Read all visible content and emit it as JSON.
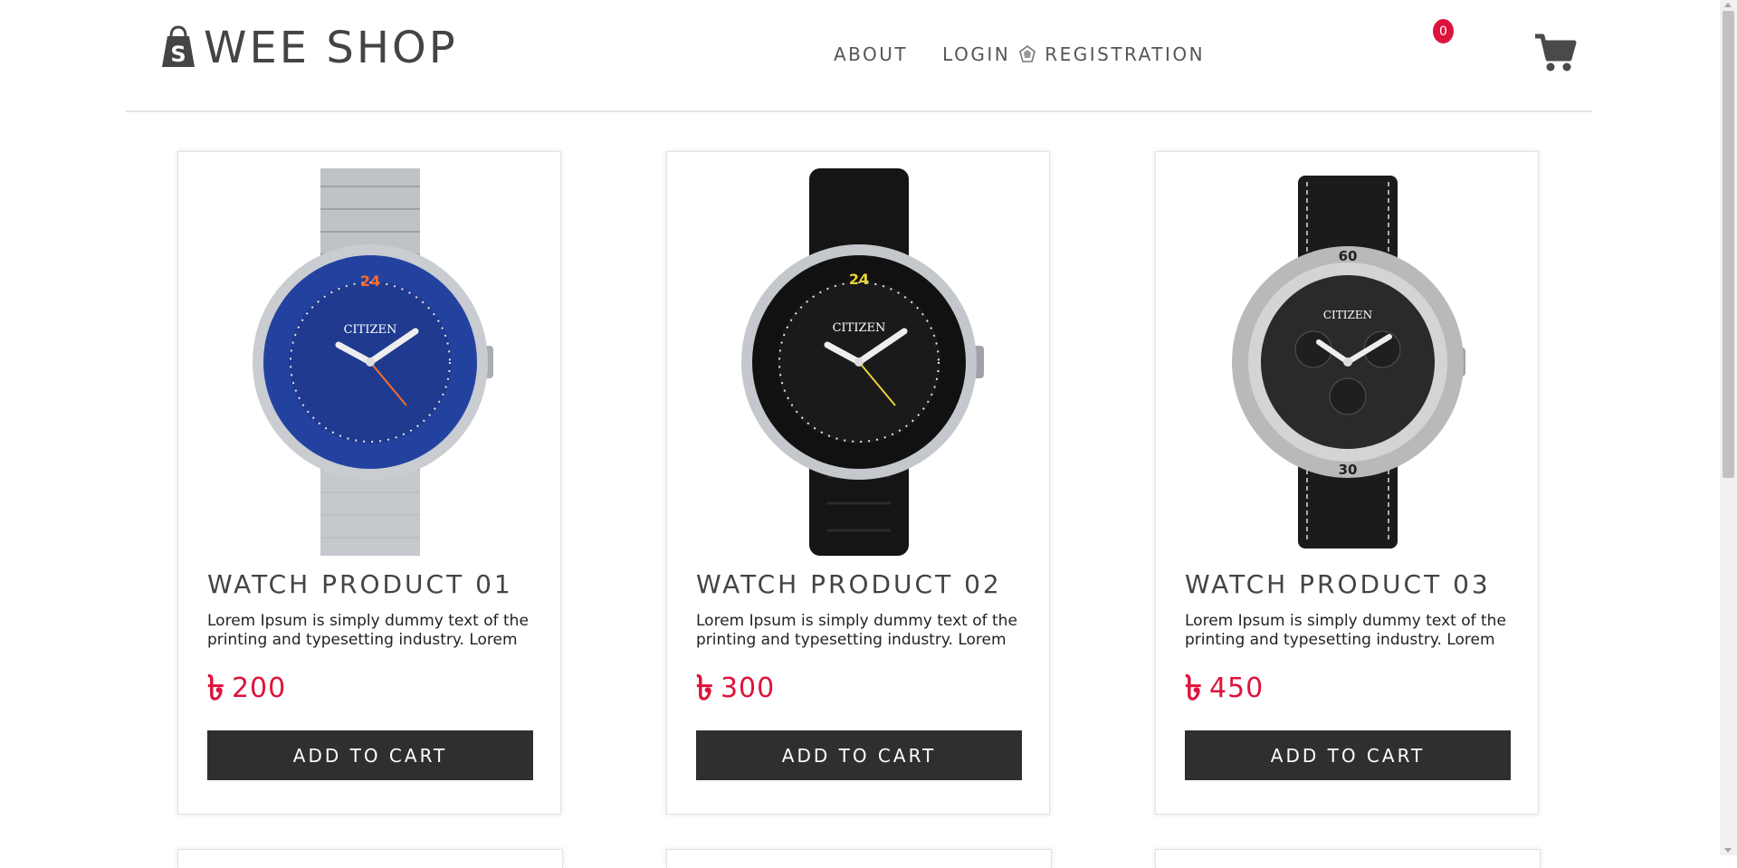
{
  "brand": {
    "name": "WEE SHOP",
    "logo_icon": "shopify-bag-icon"
  },
  "nav": {
    "about": "ABOUT",
    "login": "LOGIN",
    "separator_icon": "badge-icon",
    "registration": "REGISTRATION"
  },
  "cart": {
    "icon": "shopping-cart-icon",
    "count": "0"
  },
  "products": [
    {
      "title": "WATCH PRODUCT 01",
      "description": "Lorem Ipsum is simply dummy text of the printing and typesetting industry. Lorem",
      "currency": "৳",
      "price": "200",
      "button": "ADD TO CART",
      "dial_color": "#1f3a8f",
      "bezel_color": "#2342a0",
      "strap": "steel"
    },
    {
      "title": "WATCH PRODUCT 02",
      "description": "Lorem Ipsum is simply dummy text of the printing and typesetting industry. Lorem",
      "currency": "৳",
      "price": "300",
      "button": "ADD TO CART",
      "dial_color": "#1a1a1a",
      "bezel_color": "#111111",
      "strap": "rubber"
    },
    {
      "title": "WATCH PRODUCT 03",
      "description": "Lorem Ipsum is simply dummy text of the printing and typesetting industry. Lorem",
      "currency": "৳",
      "price": "450",
      "button": "ADD TO CART",
      "dial_color": "#2a2a2a",
      "bezel_color": "#b9b9b9",
      "strap": "leather"
    }
  ],
  "colors": {
    "accent": "#dc143c",
    "button_bg": "#2f2f2f",
    "text": "#444444"
  }
}
